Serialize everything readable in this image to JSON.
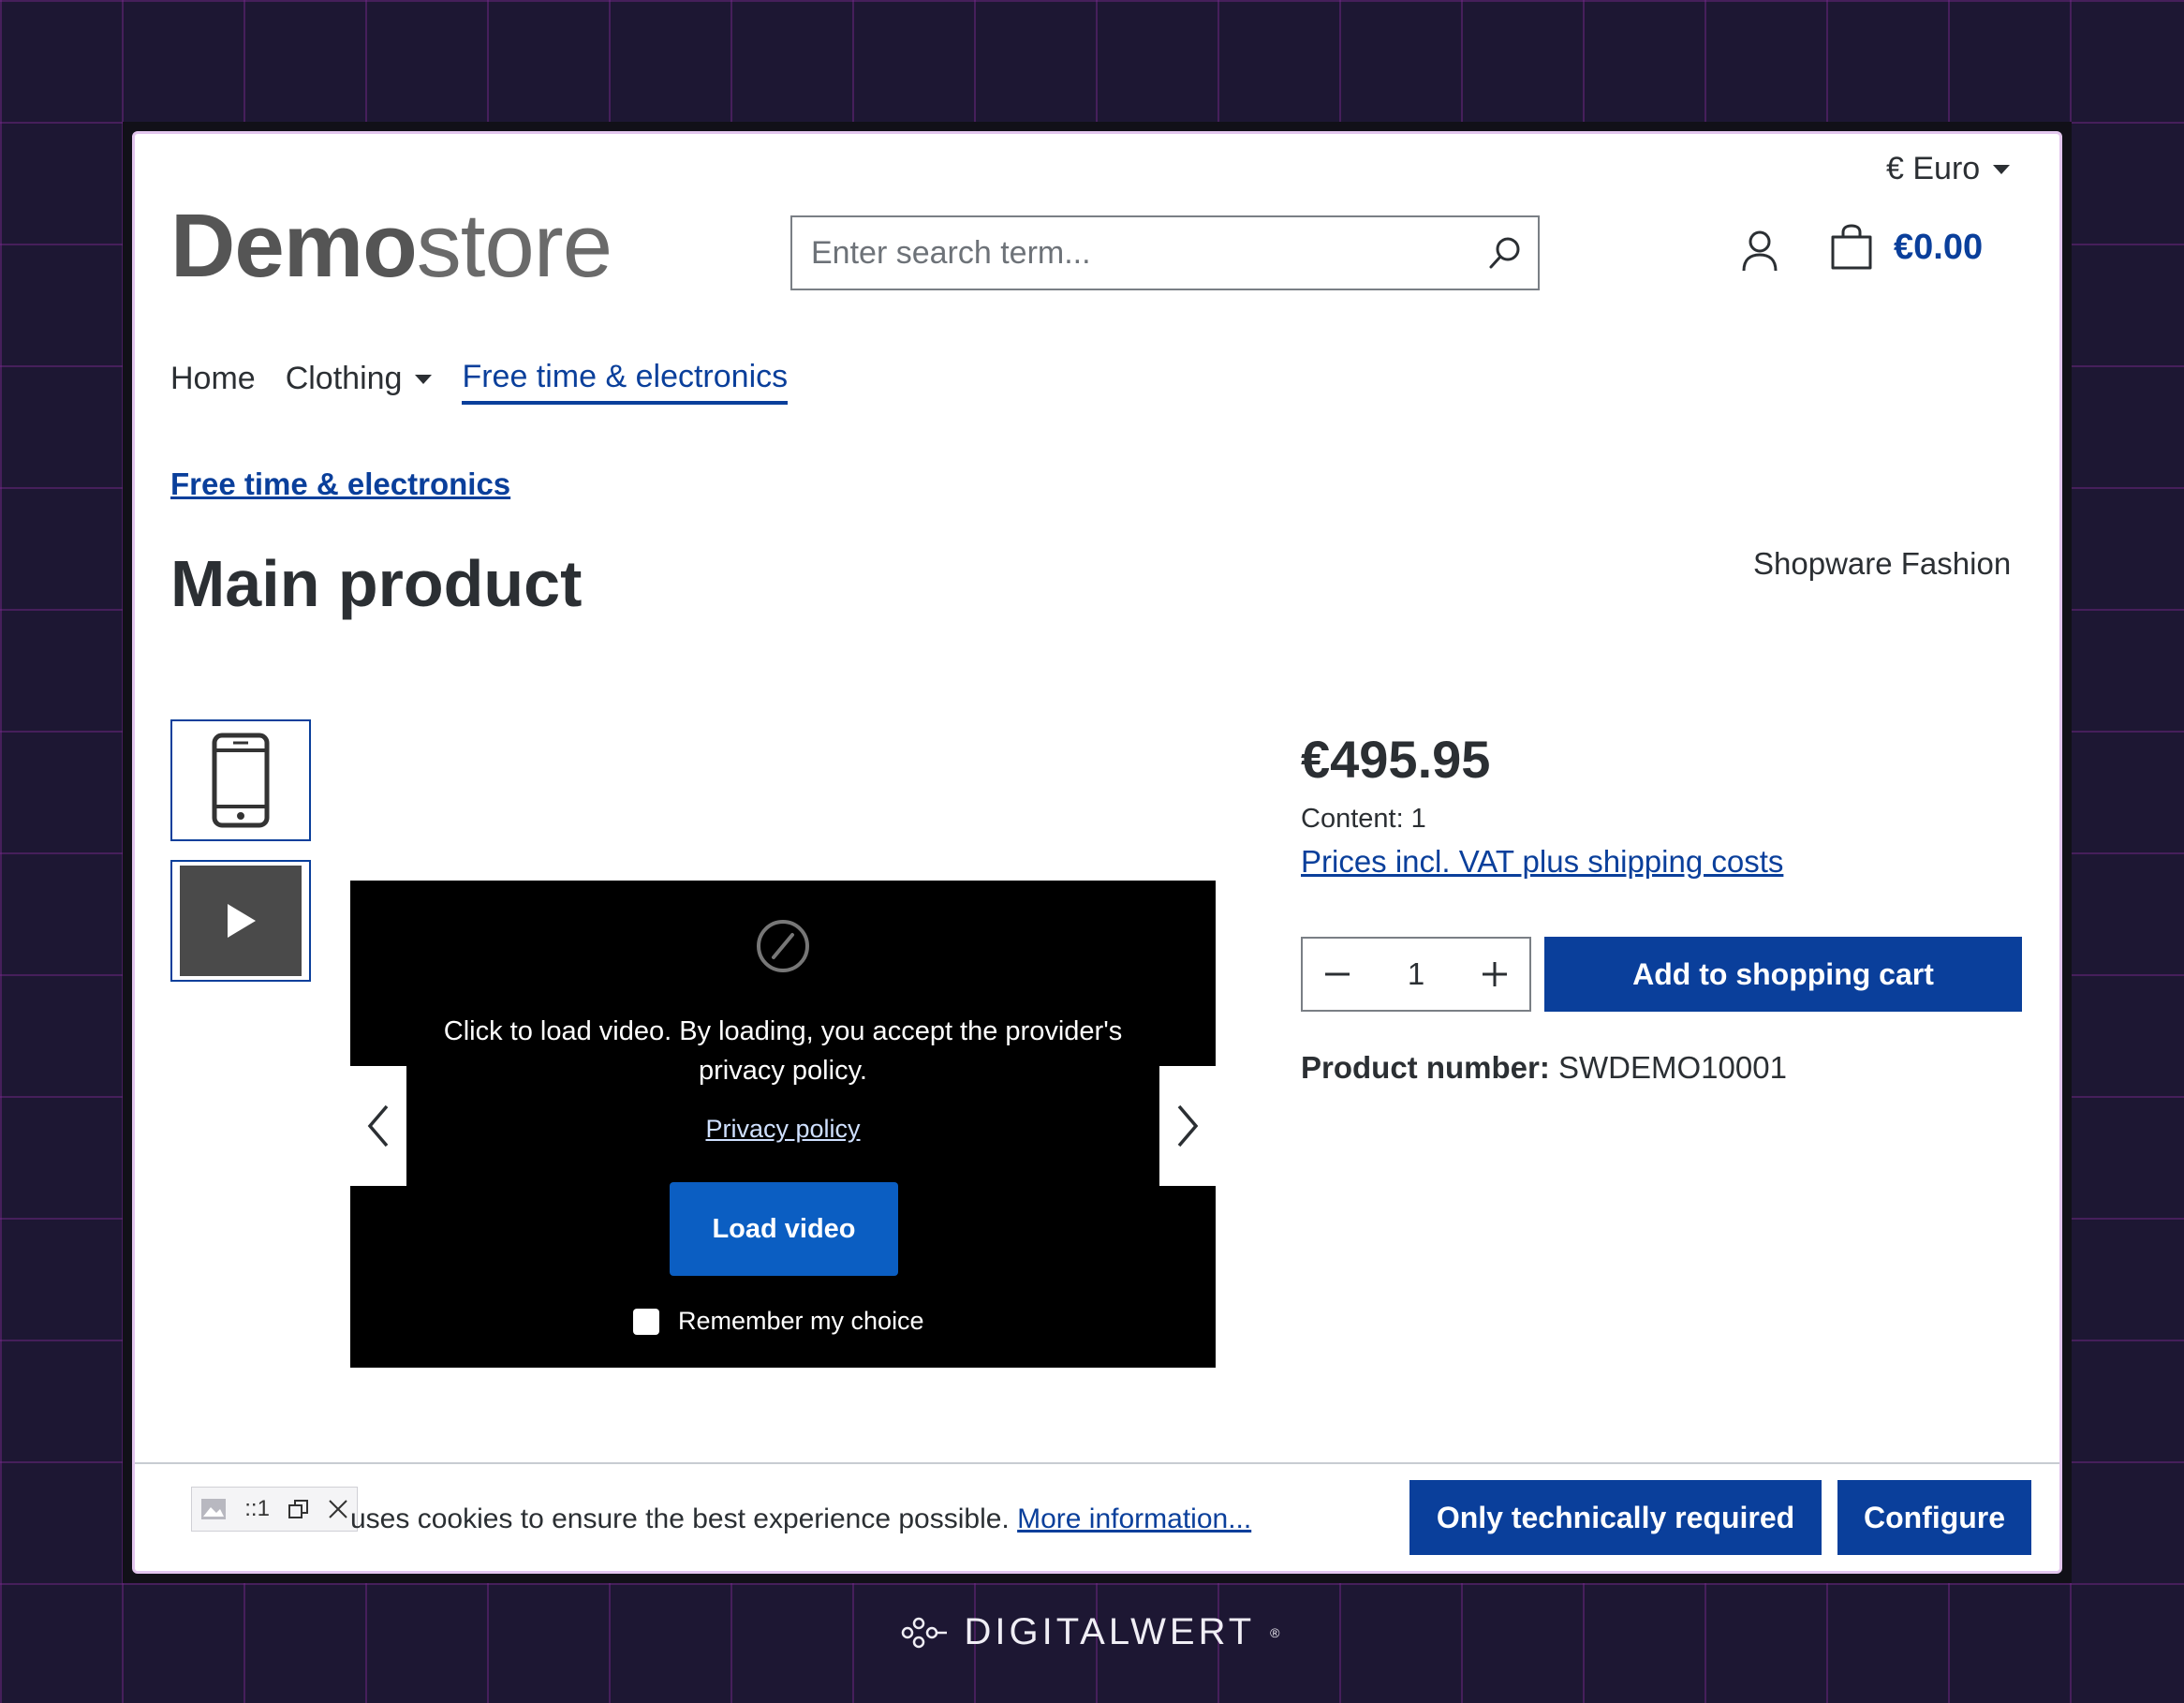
{
  "header": {
    "currency": "€ Euro",
    "logo_bold": "Demo",
    "logo_light": "store",
    "search_placeholder": "Enter search term...",
    "cart_total": "€0.00"
  },
  "nav": {
    "items": [
      {
        "label": "Home"
      },
      {
        "label": "Clothing"
      },
      {
        "label": "Free time & electronics"
      }
    ]
  },
  "breadcrumb": "Free time & electronics",
  "product": {
    "title": "Main product",
    "manufacturer": "Shopware Fashion",
    "price": "€495.95",
    "content": "Content: 1",
    "vat_note": "Prices incl. VAT plus shipping costs",
    "quantity": "1",
    "add_to_cart": "Add to shopping cart",
    "number_label": "Product number:",
    "number_value": "SWDEMO10001"
  },
  "video": {
    "notice": "Click to load video. By loading, you accept the provider's privacy policy.",
    "privacy_link": "Privacy policy",
    "load_button": "Load video",
    "remember": "Remember my choice"
  },
  "cookie": {
    "text": "uses cookies to ensure the best experience possible.",
    "more_link": "More information...",
    "required_button": "Only technically required",
    "configure_button": "Configure",
    "devtool_label": "::1"
  },
  "footer_brand": "DIGITALWERT",
  "colors": {
    "primary": "#0a3f9b",
    "load_button": "#0b5ec2",
    "background": "#1d1733",
    "grid": "#782b8c"
  }
}
